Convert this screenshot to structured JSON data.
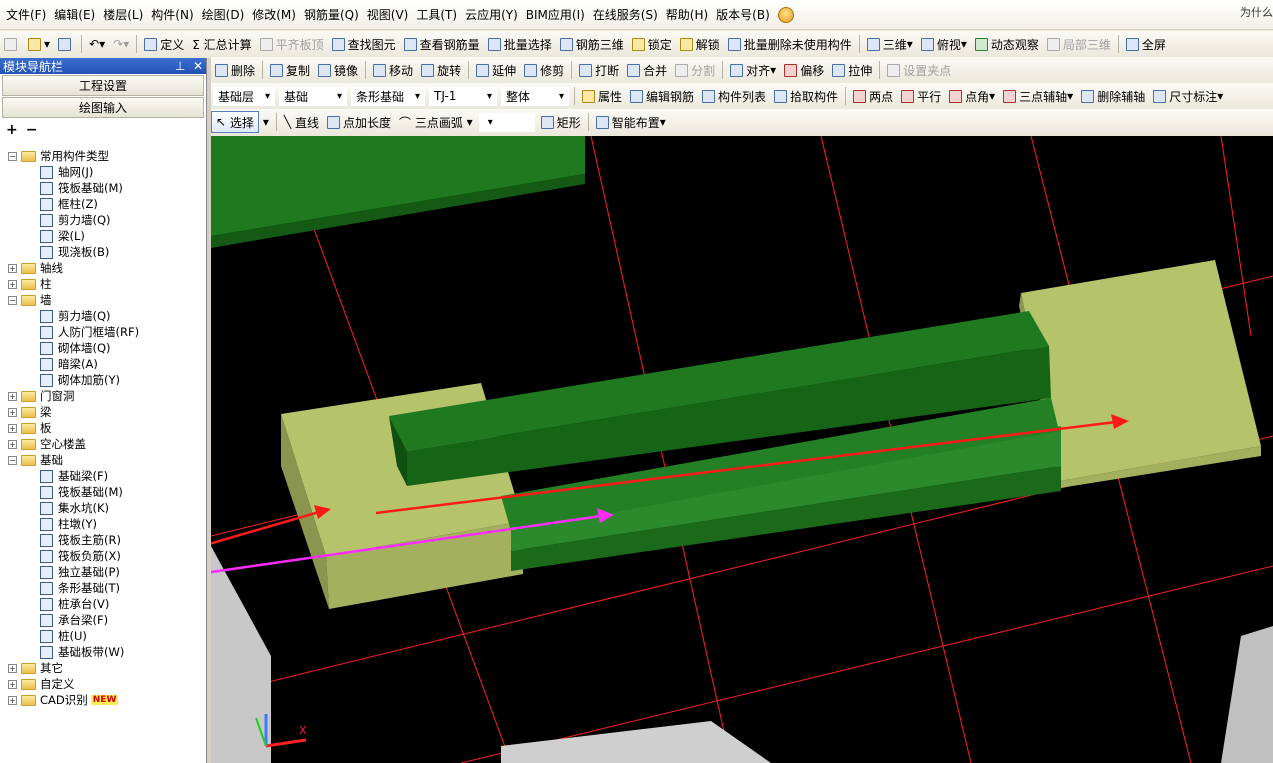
{
  "menu": [
    "文件(F)",
    "编辑(E)",
    "楼层(L)",
    "构件(N)",
    "绘图(D)",
    "修改(M)",
    "钢筋量(Q)",
    "视图(V)",
    "工具(T)",
    "云应用(Y)",
    "BIM应用(I)",
    "在线服务(S)",
    "帮助(H)",
    "版本号(B)"
  ],
  "menu_hint": "为什么",
  "toolbar1": [
    {
      "label": "定义",
      "icon": "define-icon"
    },
    {
      "label": "Σ 汇总计算",
      "icon": "sum-icon"
    },
    {
      "label": "平齐板顶",
      "icon": "align-slab-icon",
      "disabled": true
    },
    {
      "label": "查找图元",
      "icon": "find-icon"
    },
    {
      "label": "查看钢筋量",
      "icon": "view-rebar-icon"
    },
    {
      "label": "批量选择",
      "icon": "batch-select-icon"
    },
    {
      "label": "钢筋三维",
      "icon": "rebar-3d-icon"
    },
    {
      "label": "锁定",
      "icon": "lock-icon"
    },
    {
      "label": "解锁",
      "icon": "unlock-icon"
    },
    {
      "label": "批量删除未使用构件",
      "icon": "batch-delete-icon"
    },
    {
      "label": "三维",
      "icon": "3d-icon"
    },
    {
      "label": "俯视",
      "icon": "top-view-icon"
    },
    {
      "label": "动态观察",
      "icon": "orbit-icon"
    },
    {
      "label": "局部三维",
      "icon": "local-3d-icon",
      "disabled": true
    },
    {
      "label": "全屏",
      "icon": "fullscreen-icon"
    }
  ],
  "toolbar2": [
    {
      "label": "删除",
      "icon": "delete-icon"
    },
    {
      "label": "复制",
      "icon": "copy-icon"
    },
    {
      "label": "镜像",
      "icon": "mirror-icon"
    },
    {
      "label": "移动",
      "icon": "move-icon"
    },
    {
      "label": "旋转",
      "icon": "rotate-icon"
    },
    {
      "label": "延伸",
      "icon": "extend-icon"
    },
    {
      "label": "修剪",
      "icon": "trim-icon"
    },
    {
      "label": "打断",
      "icon": "break-icon"
    },
    {
      "label": "合并",
      "icon": "merge-icon"
    },
    {
      "label": "分割",
      "icon": "split-icon",
      "disabled": true
    },
    {
      "label": "对齐",
      "icon": "align-icon"
    },
    {
      "label": "偏移",
      "icon": "offset-icon"
    },
    {
      "label": "拉伸",
      "icon": "stretch-icon"
    },
    {
      "label": "设置夹点",
      "icon": "grip-icon",
      "disabled": true
    }
  ],
  "toolbar3": {
    "dropdowns": [
      "基础层",
      "基础",
      "条形基础",
      "TJ-1",
      "整体"
    ],
    "buttons": [
      {
        "label": "属性",
        "icon": "property-icon"
      },
      {
        "label": "编辑钢筋",
        "icon": "edit-rebar-icon"
      },
      {
        "label": "构件列表",
        "icon": "component-list-icon"
      },
      {
        "label": "拾取构件",
        "icon": "pick-icon"
      },
      {
        "label": "两点",
        "icon": "two-point-icon"
      },
      {
        "label": "平行",
        "icon": "parallel-icon"
      },
      {
        "label": "点角",
        "icon": "point-angle-icon"
      },
      {
        "label": "三点辅轴",
        "icon": "three-point-axis-icon"
      },
      {
        "label": "删除辅轴",
        "icon": "delete-axis-icon"
      },
      {
        "label": "尺寸标注",
        "icon": "dimension-icon"
      }
    ]
  },
  "toolbar4": [
    {
      "label": "选择",
      "icon": "select-icon"
    },
    {
      "label": "直线",
      "icon": "line-icon"
    },
    {
      "label": "点加长度",
      "icon": "point-length-icon"
    },
    {
      "label": "三点画弧",
      "icon": "arc-icon"
    },
    {
      "label": "矩形",
      "icon": "rect-icon"
    },
    {
      "label": "智能布置",
      "icon": "smart-layout-icon"
    }
  ],
  "nav": {
    "title": "模块导航栏",
    "btn_project": "工程设置",
    "btn_draw": "绘图输入",
    "tree": [
      {
        "label": "常用构件类型",
        "level": 0,
        "type": "folder",
        "expanded": true
      },
      {
        "label": "轴网(J)",
        "level": 1,
        "type": "leaf"
      },
      {
        "label": "筏板基础(M)",
        "level": 1,
        "type": "leaf"
      },
      {
        "label": "框柱(Z)",
        "level": 1,
        "type": "leaf"
      },
      {
        "label": "剪力墙(Q)",
        "level": 1,
        "type": "leaf"
      },
      {
        "label": "梁(L)",
        "level": 1,
        "type": "leaf"
      },
      {
        "label": "现浇板(B)",
        "level": 1,
        "type": "leaf"
      },
      {
        "label": "轴线",
        "level": 0,
        "type": "folder",
        "expanded": false
      },
      {
        "label": "柱",
        "level": 0,
        "type": "folder",
        "expanded": false
      },
      {
        "label": "墙",
        "level": 0,
        "type": "folder",
        "expanded": true
      },
      {
        "label": "剪力墙(Q)",
        "level": 1,
        "type": "leaf"
      },
      {
        "label": "人防门框墙(RF)",
        "level": 1,
        "type": "leaf"
      },
      {
        "label": "砌体墙(Q)",
        "level": 1,
        "type": "leaf"
      },
      {
        "label": "暗梁(A)",
        "level": 1,
        "type": "leaf"
      },
      {
        "label": "砌体加筋(Y)",
        "level": 1,
        "type": "leaf"
      },
      {
        "label": "门窗洞",
        "level": 0,
        "type": "folder",
        "expanded": false
      },
      {
        "label": "梁",
        "level": 0,
        "type": "folder",
        "expanded": false
      },
      {
        "label": "板",
        "level": 0,
        "type": "folder",
        "expanded": false
      },
      {
        "label": "空心楼盖",
        "level": 0,
        "type": "folder",
        "expanded": false
      },
      {
        "label": "基础",
        "level": 0,
        "type": "folder",
        "expanded": true
      },
      {
        "label": "基础梁(F)",
        "level": 1,
        "type": "leaf"
      },
      {
        "label": "筏板基础(M)",
        "level": 1,
        "type": "leaf"
      },
      {
        "label": "集水坑(K)",
        "level": 1,
        "type": "leaf"
      },
      {
        "label": "柱墩(Y)",
        "level": 1,
        "type": "leaf"
      },
      {
        "label": "筏板主筋(R)",
        "level": 1,
        "type": "leaf"
      },
      {
        "label": "筏板负筋(X)",
        "level": 1,
        "type": "leaf"
      },
      {
        "label": "独立基础(P)",
        "level": 1,
        "type": "leaf"
      },
      {
        "label": "条形基础(T)",
        "level": 1,
        "type": "leaf",
        "selected": true
      },
      {
        "label": "桩承台(V)",
        "level": 1,
        "type": "leaf"
      },
      {
        "label": "承台梁(F)",
        "level": 1,
        "type": "leaf"
      },
      {
        "label": "桩(U)",
        "level": 1,
        "type": "leaf"
      },
      {
        "label": "基础板带(W)",
        "level": 1,
        "type": "leaf"
      },
      {
        "label": "其它",
        "level": 0,
        "type": "folder",
        "expanded": false
      },
      {
        "label": "自定义",
        "level": 0,
        "type": "folder",
        "expanded": false
      },
      {
        "label": "CAD识别",
        "level": 0,
        "type": "folder",
        "expanded": false,
        "badge": "NEW"
      }
    ]
  },
  "view3d": {
    "axis_x_label": "X",
    "colors": {
      "background": "#000000",
      "pad": "#b5c46a",
      "strip": "#1f7a1f",
      "grid": "#ff2020",
      "arrow_red": "#ff1a1a",
      "arrow_magenta": "#ff2cff"
    }
  }
}
